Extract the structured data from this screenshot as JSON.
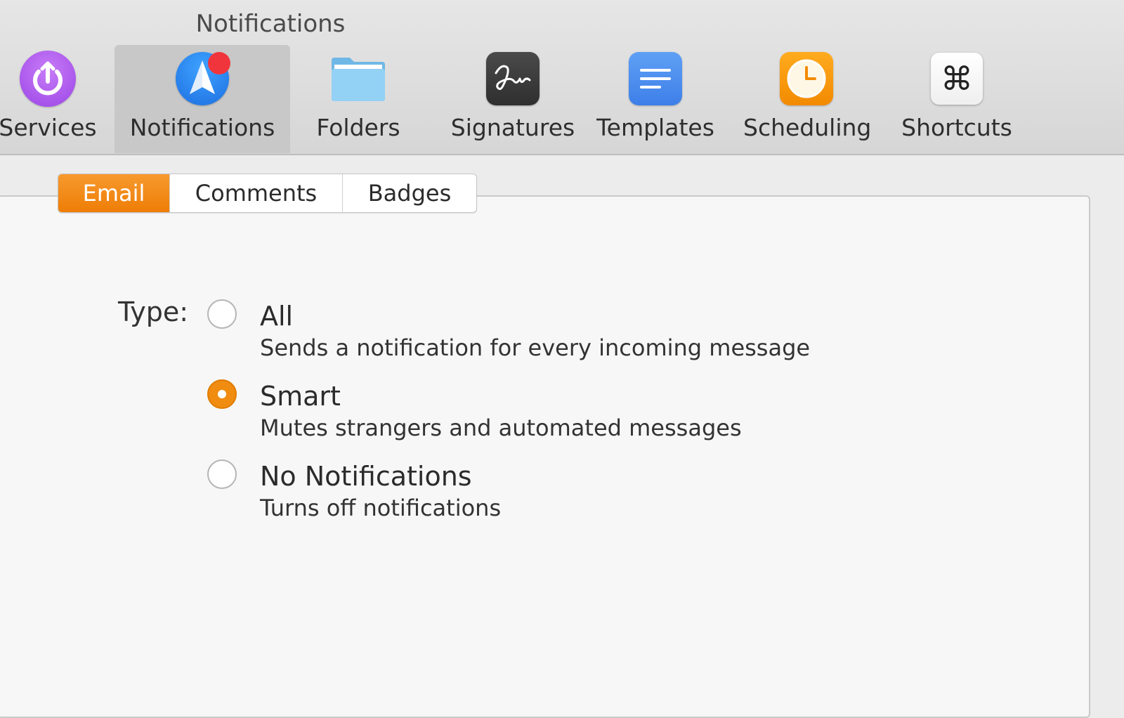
{
  "window": {
    "title": "Notifications"
  },
  "toolbar": {
    "items": [
      {
        "label": "Services",
        "icon": "power-icon"
      },
      {
        "label": "Notifications",
        "icon": "spark-paper-plane-icon",
        "active": true
      },
      {
        "label": "Folders",
        "icon": "folder-icon"
      },
      {
        "label": "Signatures",
        "icon": "signature-icon"
      },
      {
        "label": "Templates",
        "icon": "text-lines-icon"
      },
      {
        "label": "Scheduling",
        "icon": "clock-icon"
      },
      {
        "label": "Shortcuts",
        "icon": "command-key-icon",
        "glyph": "⌘"
      }
    ]
  },
  "tabs": {
    "items": [
      {
        "label": "Email",
        "selected": true
      },
      {
        "label": "Comments"
      },
      {
        "label": "Badges"
      }
    ]
  },
  "settings": {
    "type_label": "Type:",
    "options": [
      {
        "title": "All",
        "description": "Sends a notification for every incoming message",
        "selected": false
      },
      {
        "title": "Smart",
        "description": "Mutes strangers and automated messages",
        "selected": true
      },
      {
        "title": "No Notifications",
        "description": "Turns off notifications",
        "selected": false
      }
    ]
  },
  "colors": {
    "accent": "#EE7D06",
    "notification_badge": "#F0363C",
    "services_icon": "#9B45E6",
    "templates_icon": "#3D7FE8",
    "scheduling_icon": "#F28A00"
  }
}
